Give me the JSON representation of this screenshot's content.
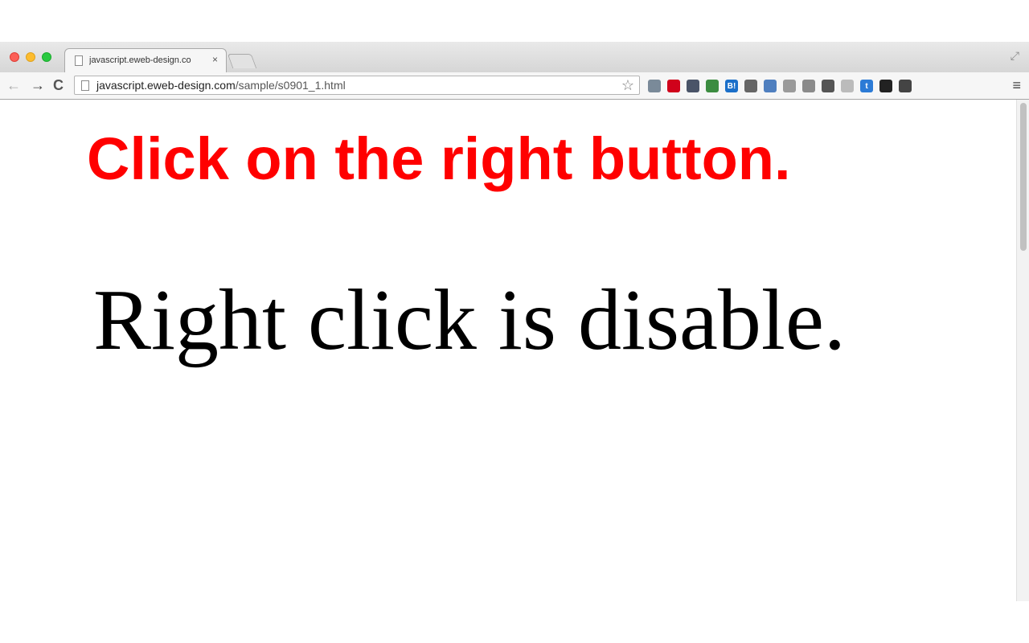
{
  "browser": {
    "tab_title": "javascript.eweb-design.co",
    "tab_close": "×",
    "url_host": "javascript.eweb-design.com",
    "url_path": "/sample/s0901_1.html",
    "nav": {
      "back": "←",
      "forward": "→",
      "reload": "C"
    },
    "star": "☆",
    "menu": "≡",
    "fullscreen": "⤢",
    "extensions": [
      {
        "name": "evernote-icon",
        "label": "",
        "color": "#7a8a99"
      },
      {
        "name": "dual-circle-icon",
        "label": "",
        "color": "#d0021b"
      },
      {
        "name": "pocket-icon",
        "label": "",
        "color": "#4a5468"
      },
      {
        "name": "translate-icon",
        "label": "",
        "color": "#3c8c40"
      },
      {
        "name": "hatena-bookmark-icon",
        "label": "B!",
        "color": "#1b6fc9"
      },
      {
        "name": "wave-icon",
        "label": "",
        "color": "#666666"
      },
      {
        "name": "window-icon",
        "label": "",
        "color": "#4f7fbf"
      },
      {
        "name": "globe-icon",
        "label": "",
        "color": "#9a9a9a"
      },
      {
        "name": "list-icon",
        "label": "",
        "color": "#8a8a8a"
      },
      {
        "name": "hat-icon",
        "label": "",
        "color": "#555555"
      },
      {
        "name": "dash-icon",
        "label": "",
        "color": "#bbbbbb"
      },
      {
        "name": "tumblr-icon",
        "label": "t",
        "color": "#2c7bd6"
      },
      {
        "name": "qr-code-icon",
        "label": "",
        "color": "#222222"
      },
      {
        "name": "disguise-icon",
        "label": "",
        "color": "#444444"
      }
    ]
  },
  "page": {
    "heading": "Click on the right button.",
    "message": "Right click is disable."
  },
  "colors": {
    "heading": "#ff0000",
    "message": "#000000"
  }
}
